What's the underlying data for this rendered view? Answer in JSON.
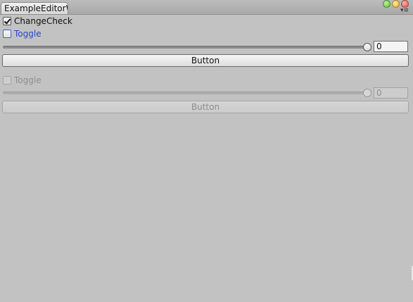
{
  "window": {
    "tab_title": "ExampleEditorW",
    "menu_glyph": "▾≡",
    "buttons": {
      "minimize_color": "#5fc13a",
      "maximize_color": "#f0b531",
      "close_color": "#e25245"
    }
  },
  "enabled_group": {
    "change_check": {
      "label": "ChangeCheck",
      "checked": true
    },
    "toggle": {
      "label": "Toggle",
      "checked": false
    },
    "slider": {
      "value": "0"
    },
    "button": {
      "label": "Button"
    }
  },
  "disabled_group": {
    "toggle": {
      "label": "Toggle",
      "checked": false
    },
    "slider": {
      "value": "0"
    },
    "button": {
      "label": "Button"
    }
  }
}
